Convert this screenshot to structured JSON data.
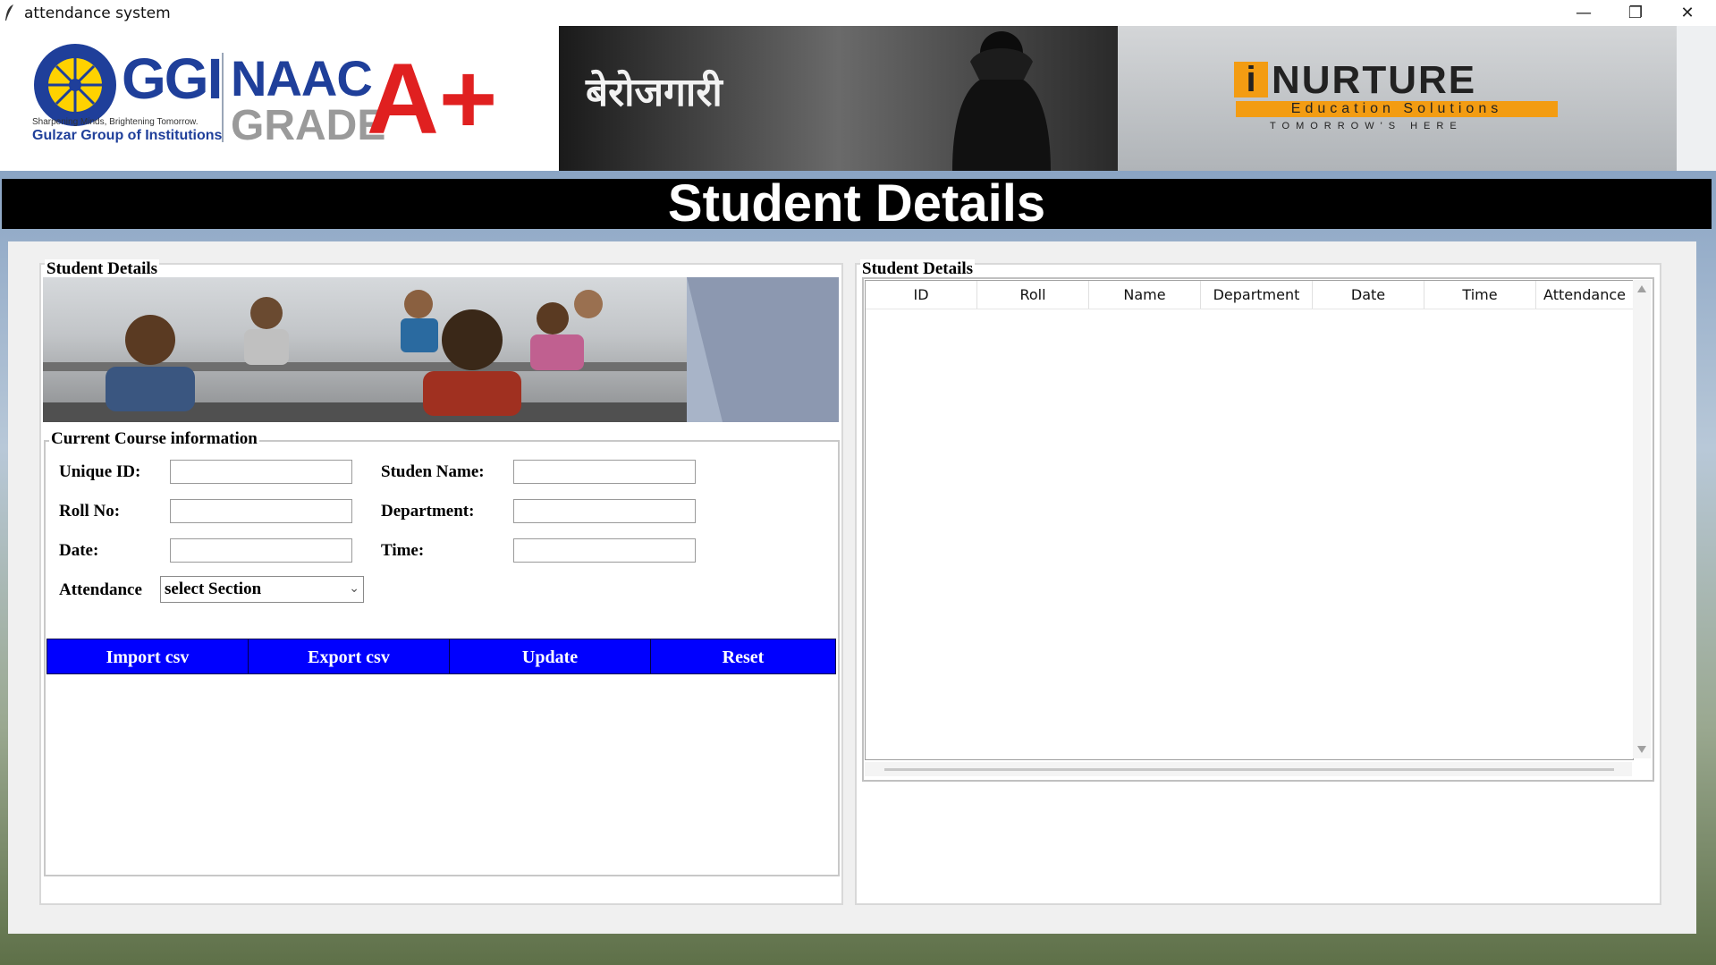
{
  "window": {
    "title": "attendance system",
    "minimize_glyph": "—",
    "restore_glyph": "❐",
    "close_glyph": "✕"
  },
  "banners": {
    "ggi_text": "GGI",
    "ggi_tagline": "Sharpening Minds, Brightening Tomorrow.",
    "ggi_name": "Gulzar Group of Institutions",
    "naac_line1": "NAAC",
    "naac_line2": "GRADE",
    "naac_grade": "A+",
    "hindi_text": "बेरोजगारी",
    "nurture_i": "i",
    "nurture_name": "NURTURE",
    "nurture_sub": "Education Solutions",
    "nurture_tag": "TOMORROW'S HERE"
  },
  "heading": "Student Details",
  "left_panel": {
    "title": "Student Details",
    "course_frame_title": "Current Course information",
    "labels": {
      "unique_id": "Unique ID:",
      "student_name": "Studen Name:",
      "roll_no": "Roll No:",
      "department": "Department:",
      "date": "Date:",
      "time": "Time:",
      "attendance": "Attendance"
    },
    "attendance_select_value": "select Section",
    "buttons": {
      "import": "Import csv",
      "export": "Export csv",
      "update": "Update",
      "reset": "Reset"
    }
  },
  "right_panel": {
    "title": "Student Details",
    "columns": [
      "ID",
      "Roll",
      "Name",
      "Department",
      "Date",
      "Time",
      "Attendance"
    ]
  },
  "colors": {
    "button_blue": "#0000ff",
    "heading_bg": "#000000",
    "heading_text": "#ffffff",
    "naac_red": "#e02020",
    "ggi_blue": "#1f3f9a"
  }
}
